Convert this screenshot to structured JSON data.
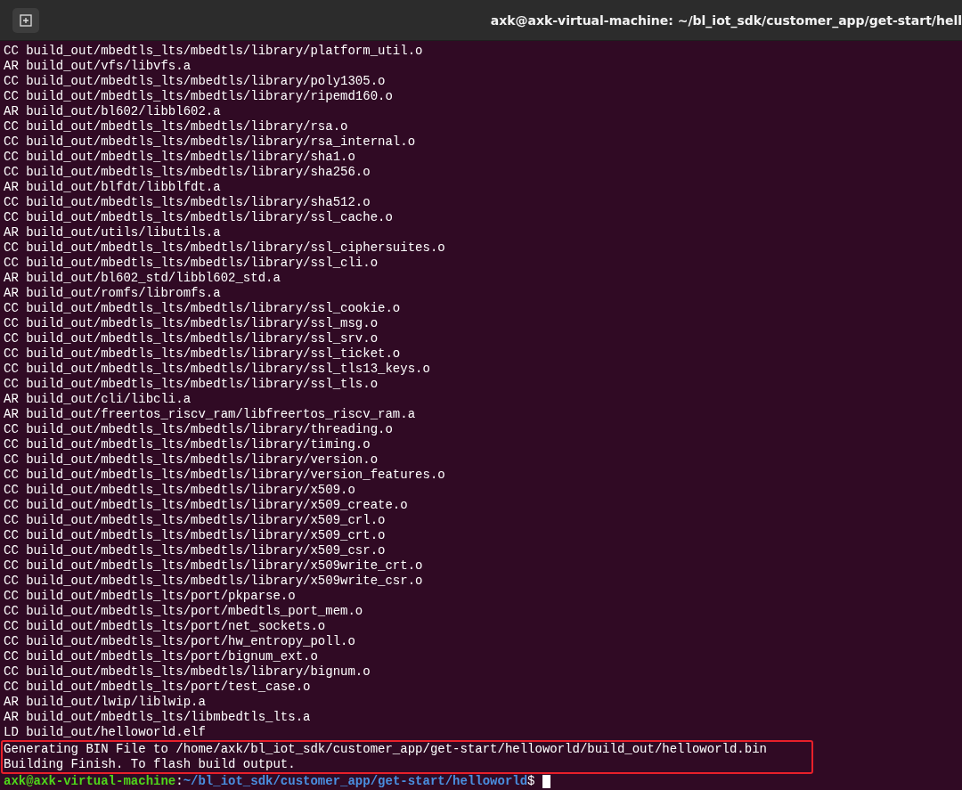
{
  "window": {
    "title": "axk@axk-virtual-machine: ~/bl_iot_sdk/customer_app/get-start/hell"
  },
  "output": [
    "CC build_out/mbedtls_lts/mbedtls/library/platform_util.o",
    "AR build_out/vfs/libvfs.a",
    "CC build_out/mbedtls_lts/mbedtls/library/poly1305.o",
    "CC build_out/mbedtls_lts/mbedtls/library/ripemd160.o",
    "AR build_out/bl602/libbl602.a",
    "CC build_out/mbedtls_lts/mbedtls/library/rsa.o",
    "CC build_out/mbedtls_lts/mbedtls/library/rsa_internal.o",
    "CC build_out/mbedtls_lts/mbedtls/library/sha1.o",
    "CC build_out/mbedtls_lts/mbedtls/library/sha256.o",
    "AR build_out/blfdt/libblfdt.a",
    "CC build_out/mbedtls_lts/mbedtls/library/sha512.o",
    "CC build_out/mbedtls_lts/mbedtls/library/ssl_cache.o",
    "AR build_out/utils/libutils.a",
    "CC build_out/mbedtls_lts/mbedtls/library/ssl_ciphersuites.o",
    "CC build_out/mbedtls_lts/mbedtls/library/ssl_cli.o",
    "AR build_out/bl602_std/libbl602_std.a",
    "AR build_out/romfs/libromfs.a",
    "CC build_out/mbedtls_lts/mbedtls/library/ssl_cookie.o",
    "CC build_out/mbedtls_lts/mbedtls/library/ssl_msg.o",
    "CC build_out/mbedtls_lts/mbedtls/library/ssl_srv.o",
    "CC build_out/mbedtls_lts/mbedtls/library/ssl_ticket.o",
    "CC build_out/mbedtls_lts/mbedtls/library/ssl_tls13_keys.o",
    "CC build_out/mbedtls_lts/mbedtls/library/ssl_tls.o",
    "AR build_out/cli/libcli.a",
    "AR build_out/freertos_riscv_ram/libfreertos_riscv_ram.a",
    "CC build_out/mbedtls_lts/mbedtls/library/threading.o",
    "CC build_out/mbedtls_lts/mbedtls/library/timing.o",
    "CC build_out/mbedtls_lts/mbedtls/library/version.o",
    "CC build_out/mbedtls_lts/mbedtls/library/version_features.o",
    "CC build_out/mbedtls_lts/mbedtls/library/x509.o",
    "CC build_out/mbedtls_lts/mbedtls/library/x509_create.o",
    "CC build_out/mbedtls_lts/mbedtls/library/x509_crl.o",
    "CC build_out/mbedtls_lts/mbedtls/library/x509_crt.o",
    "CC build_out/mbedtls_lts/mbedtls/library/x509_csr.o",
    "CC build_out/mbedtls_lts/mbedtls/library/x509write_crt.o",
    "CC build_out/mbedtls_lts/mbedtls/library/x509write_csr.o",
    "CC build_out/mbedtls_lts/port/pkparse.o",
    "CC build_out/mbedtls_lts/port/mbedtls_port_mem.o",
    "CC build_out/mbedtls_lts/port/net_sockets.o",
    "CC build_out/mbedtls_lts/port/hw_entropy_poll.o",
    "CC build_out/mbedtls_lts/port/bignum_ext.o",
    "CC build_out/mbedtls_lts/mbedtls/library/bignum.o",
    "CC build_out/mbedtls_lts/port/test_case.o",
    "AR build_out/lwip/liblwip.a",
    "AR build_out/mbedtls_lts/libmbedtls_lts.a",
    "LD build_out/helloworld.elf"
  ],
  "highlighted_output": [
    "Generating BIN File to /home/axk/bl_iot_sdk/customer_app/get-start/helloworld/build_out/helloworld.bin",
    "Building Finish. To flash build output."
  ],
  "prompt": {
    "user_host": "axk@axk-virtual-machine",
    "separator": ":",
    "path": "~/bl_iot_sdk/customer_app/get-start/helloworld",
    "symbol": "$"
  }
}
